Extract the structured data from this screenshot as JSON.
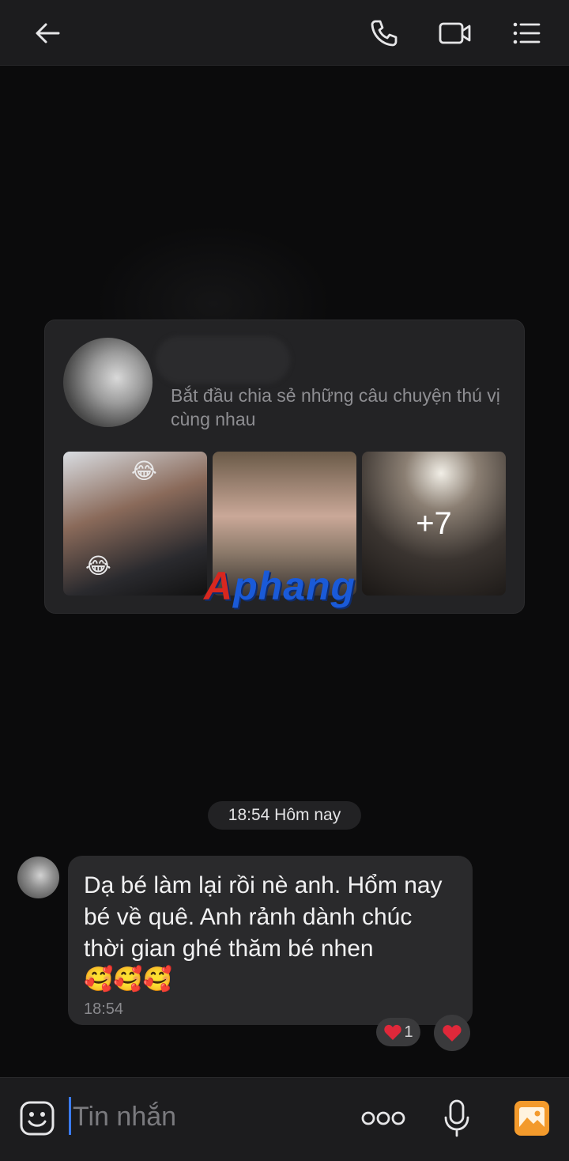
{
  "header": {
    "icons": [
      "back-arrow-icon",
      "phone-icon",
      "video-call-icon",
      "list-menu-icon"
    ]
  },
  "profile_card": {
    "description": "Bắt đầu chia sẻ những câu chuyện thú vị cùng nhau",
    "more_photos": "+7",
    "sticker_emoji": "😂"
  },
  "watermark": {
    "first_letter": "A",
    "rest": "phang"
  },
  "chat": {
    "date_divider": "18:54 Hôm nay",
    "message": {
      "text": "Dạ bé làm lại rồi nè anh. Hổm nay bé về quê. Anh rảnh dành chúc thời gian ghé thăm bé nhen",
      "emojis": "🥰🥰🥰",
      "time": "18:54",
      "reaction_emoji": "❤️",
      "reaction_count": "1"
    }
  },
  "input_bar": {
    "placeholder": "Tin nhắn"
  },
  "colors": {
    "background": "#0b0b0c",
    "bar": "#1c1c1e",
    "bubble": "#2a2a2c",
    "accent": "#3a7bf2",
    "heart": "#e0283a",
    "image_button": "#f39a2c"
  }
}
